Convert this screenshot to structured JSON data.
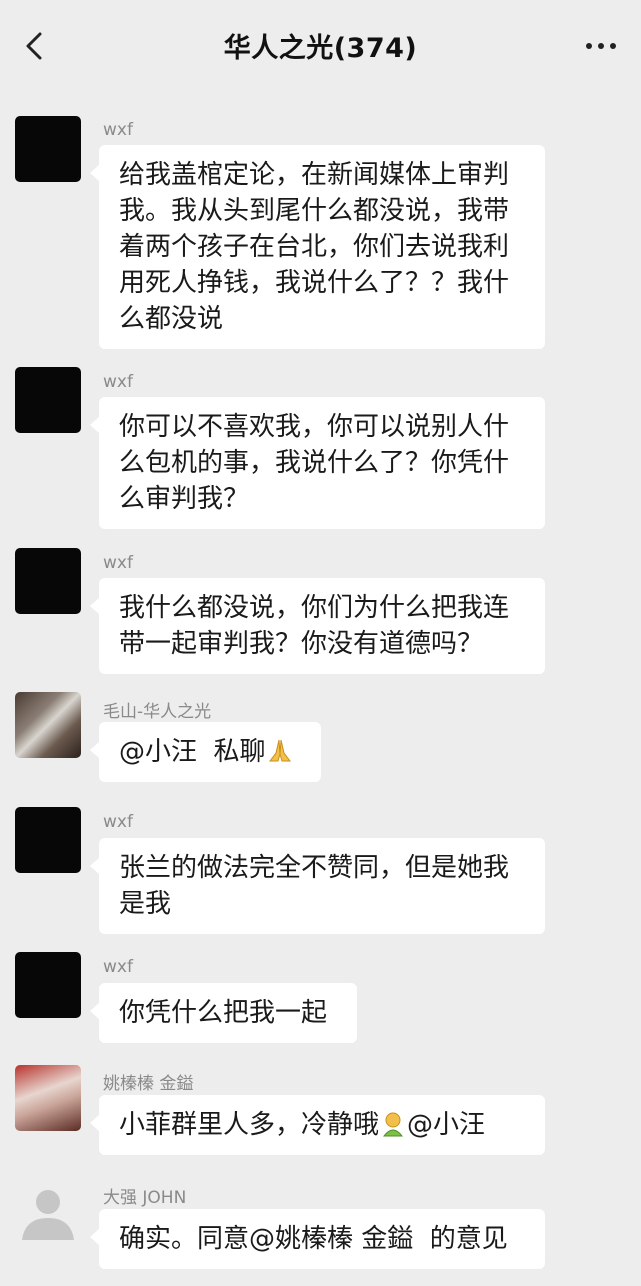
{
  "header": {
    "title": "华人之光(374)",
    "back_icon": "chevron-left-icon",
    "more_icon": "ellipsis-icon"
  },
  "messages": [
    {
      "sender": "wxf",
      "avatar": "black",
      "lines": [
        "给我盖棺定论，在新闻媒体上审判",
        "我。我从头到尾什么都没说，我带",
        "着两个孩子在台北，你们去说我利",
        "用死人挣钱，我说什么了？？我什",
        "么都没说"
      ]
    },
    {
      "sender": "wxf",
      "avatar": "black",
      "lines": [
        "你可以不喜欢我，你可以说别人什",
        "么包机的事，我说什么了？你凭什",
        "么审判我？"
      ]
    },
    {
      "sender": "wxf",
      "avatar": "black",
      "lines": [
        "我什么都没说，你们为什么把我连",
        "带一起审判我？你没有道德吗？"
      ]
    },
    {
      "sender": "毛山-华人之光",
      "avatar": "photo",
      "text": "@小汪  私聊",
      "emoji": "praying-hands-emoji"
    },
    {
      "sender": "wxf",
      "avatar": "black",
      "lines": [
        "张兰的做法完全不赞同，但是她我",
        "是我"
      ]
    },
    {
      "sender": "wxf",
      "avatar": "black",
      "lines": [
        "你凭什么把我一起"
      ]
    },
    {
      "sender": "姚榛榛 金鎰",
      "avatar": "photo",
      "text_before": "小菲群里人多，冷静哦",
      "emoji": "face-emoji",
      "text_after": "@小汪"
    },
    {
      "sender": "大强 JOHN",
      "avatar": "default",
      "lines": [
        "确实。同意@姚榛榛 金鎰  的意见"
      ]
    }
  ]
}
